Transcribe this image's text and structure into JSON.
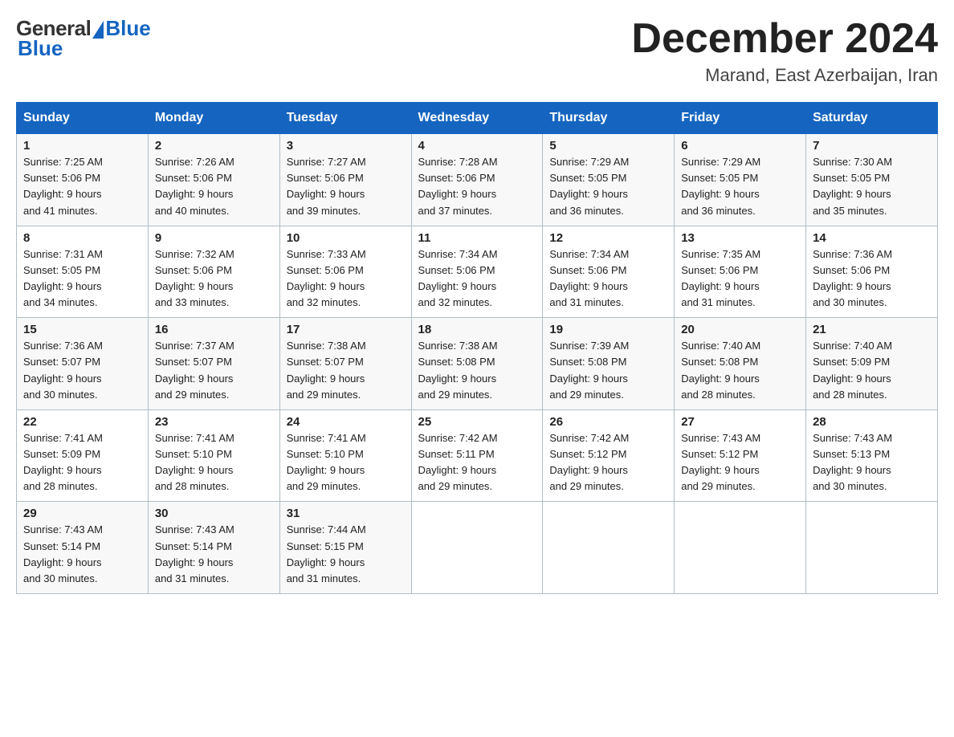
{
  "logo": {
    "general": "General",
    "blue": "Blue"
  },
  "header": {
    "title": "December 2024",
    "location": "Marand, East Azerbaijan, Iran"
  },
  "days_of_week": [
    "Sunday",
    "Monday",
    "Tuesday",
    "Wednesday",
    "Thursday",
    "Friday",
    "Saturday"
  ],
  "weeks": [
    [
      {
        "day": "1",
        "sunrise": "7:25 AM",
        "sunset": "5:06 PM",
        "daylight": "9 hours and 41 minutes."
      },
      {
        "day": "2",
        "sunrise": "7:26 AM",
        "sunset": "5:06 PM",
        "daylight": "9 hours and 40 minutes."
      },
      {
        "day": "3",
        "sunrise": "7:27 AM",
        "sunset": "5:06 PM",
        "daylight": "9 hours and 39 minutes."
      },
      {
        "day": "4",
        "sunrise": "7:28 AM",
        "sunset": "5:06 PM",
        "daylight": "9 hours and 37 minutes."
      },
      {
        "day": "5",
        "sunrise": "7:29 AM",
        "sunset": "5:05 PM",
        "daylight": "9 hours and 36 minutes."
      },
      {
        "day": "6",
        "sunrise": "7:29 AM",
        "sunset": "5:05 PM",
        "daylight": "9 hours and 36 minutes."
      },
      {
        "day": "7",
        "sunrise": "7:30 AM",
        "sunset": "5:05 PM",
        "daylight": "9 hours and 35 minutes."
      }
    ],
    [
      {
        "day": "8",
        "sunrise": "7:31 AM",
        "sunset": "5:05 PM",
        "daylight": "9 hours and 34 minutes."
      },
      {
        "day": "9",
        "sunrise": "7:32 AM",
        "sunset": "5:06 PM",
        "daylight": "9 hours and 33 minutes."
      },
      {
        "day": "10",
        "sunrise": "7:33 AM",
        "sunset": "5:06 PM",
        "daylight": "9 hours and 32 minutes."
      },
      {
        "day": "11",
        "sunrise": "7:34 AM",
        "sunset": "5:06 PM",
        "daylight": "9 hours and 32 minutes."
      },
      {
        "day": "12",
        "sunrise": "7:34 AM",
        "sunset": "5:06 PM",
        "daylight": "9 hours and 31 minutes."
      },
      {
        "day": "13",
        "sunrise": "7:35 AM",
        "sunset": "5:06 PM",
        "daylight": "9 hours and 31 minutes."
      },
      {
        "day": "14",
        "sunrise": "7:36 AM",
        "sunset": "5:06 PM",
        "daylight": "9 hours and 30 minutes."
      }
    ],
    [
      {
        "day": "15",
        "sunrise": "7:36 AM",
        "sunset": "5:07 PM",
        "daylight": "9 hours and 30 minutes."
      },
      {
        "day": "16",
        "sunrise": "7:37 AM",
        "sunset": "5:07 PM",
        "daylight": "9 hours and 29 minutes."
      },
      {
        "day": "17",
        "sunrise": "7:38 AM",
        "sunset": "5:07 PM",
        "daylight": "9 hours and 29 minutes."
      },
      {
        "day": "18",
        "sunrise": "7:38 AM",
        "sunset": "5:08 PM",
        "daylight": "9 hours and 29 minutes."
      },
      {
        "day": "19",
        "sunrise": "7:39 AM",
        "sunset": "5:08 PM",
        "daylight": "9 hours and 29 minutes."
      },
      {
        "day": "20",
        "sunrise": "7:40 AM",
        "sunset": "5:08 PM",
        "daylight": "9 hours and 28 minutes."
      },
      {
        "day": "21",
        "sunrise": "7:40 AM",
        "sunset": "5:09 PM",
        "daylight": "9 hours and 28 minutes."
      }
    ],
    [
      {
        "day": "22",
        "sunrise": "7:41 AM",
        "sunset": "5:09 PM",
        "daylight": "9 hours and 28 minutes."
      },
      {
        "day": "23",
        "sunrise": "7:41 AM",
        "sunset": "5:10 PM",
        "daylight": "9 hours and 28 minutes."
      },
      {
        "day": "24",
        "sunrise": "7:41 AM",
        "sunset": "5:10 PM",
        "daylight": "9 hours and 29 minutes."
      },
      {
        "day": "25",
        "sunrise": "7:42 AM",
        "sunset": "5:11 PM",
        "daylight": "9 hours and 29 minutes."
      },
      {
        "day": "26",
        "sunrise": "7:42 AM",
        "sunset": "5:12 PM",
        "daylight": "9 hours and 29 minutes."
      },
      {
        "day": "27",
        "sunrise": "7:43 AM",
        "sunset": "5:12 PM",
        "daylight": "9 hours and 29 minutes."
      },
      {
        "day": "28",
        "sunrise": "7:43 AM",
        "sunset": "5:13 PM",
        "daylight": "9 hours and 30 minutes."
      }
    ],
    [
      {
        "day": "29",
        "sunrise": "7:43 AM",
        "sunset": "5:14 PM",
        "daylight": "9 hours and 30 minutes."
      },
      {
        "day": "30",
        "sunrise": "7:43 AM",
        "sunset": "5:14 PM",
        "daylight": "9 hours and 31 minutes."
      },
      {
        "day": "31",
        "sunrise": "7:44 AM",
        "sunset": "5:15 PM",
        "daylight": "9 hours and 31 minutes."
      },
      null,
      null,
      null,
      null
    ]
  ],
  "labels": {
    "sunrise": "Sunrise:",
    "sunset": "Sunset:",
    "daylight": "Daylight:"
  }
}
